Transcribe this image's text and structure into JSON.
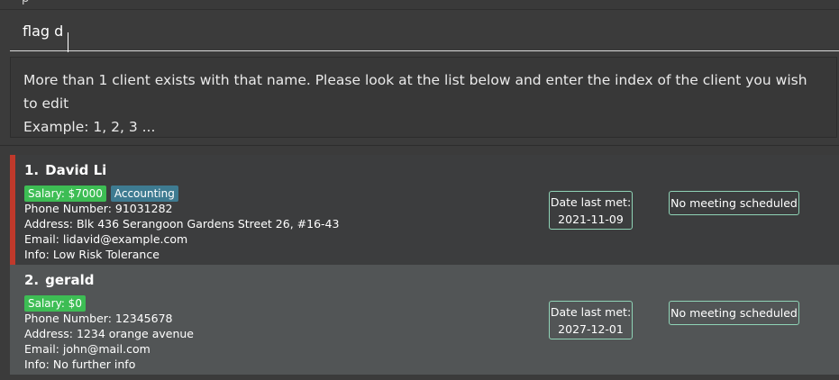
{
  "top_fragment": "p",
  "command": {
    "value": "flag d"
  },
  "result": {
    "line1": "More than 1 client exists with that name. Please look at the list below and enter the index of the client you wish to edit",
    "line2": "Example: 1, 2, 3 ..."
  },
  "clients": [
    {
      "index": "1.",
      "name": "David Li",
      "salary_tag": "Salary: $7000",
      "dept_tag": "Accounting",
      "phone": "Phone Number: 91031282",
      "address": "Address: Blk 436 Serangoon Gardens Street 26, #16-43",
      "email": "Email: lidavid@example.com",
      "info": "Info: Low Risk Tolerance",
      "date_label": "Date last met:",
      "date_value": "2021-11-09",
      "meeting": "No meeting scheduled"
    },
    {
      "index": "2.",
      "name": "gerald",
      "salary_tag": "Salary: $0",
      "phone": "Phone Number: 12345678",
      "address": "Address: 1234 orange avenue",
      "email": "Email: john@mail.com",
      "info": "Info: No further info",
      "date_label": "Date last met:",
      "date_value": "2027-12-01",
      "meeting": "No meeting scheduled"
    }
  ],
  "colors": {
    "selection_bar": "#c0392b",
    "salary_tag": "#3dbd54",
    "dept_tag": "#3e7b91",
    "chip_border": "#8fd3b6"
  }
}
